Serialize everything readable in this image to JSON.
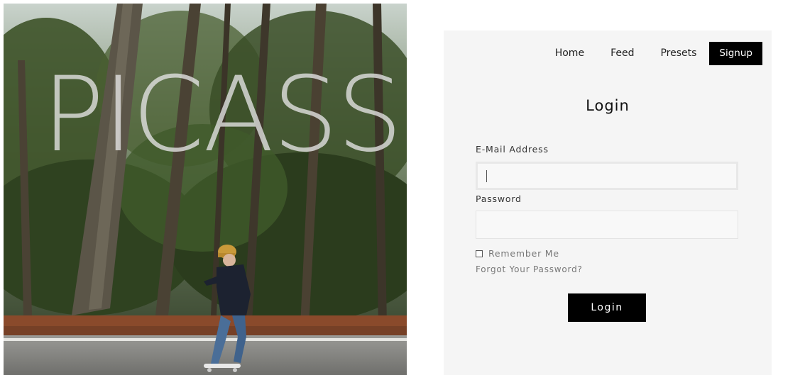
{
  "hero": {
    "brand_text": "PICASSO"
  },
  "nav": {
    "items": [
      {
        "label": "Home"
      },
      {
        "label": "Feed"
      },
      {
        "label": "Presets"
      }
    ],
    "signup_label": "Signup"
  },
  "login_form": {
    "title": "Login",
    "email_label": "E-Mail Address",
    "email_value": "",
    "password_label": "Password",
    "password_value": "",
    "remember_label": "Remember Me",
    "remember_checked": false,
    "forgot_label": "Forgot Your Password?",
    "submit_label": "Login"
  },
  "colors": {
    "card_background": "#f5f5f5",
    "button_background": "#000000",
    "button_text": "#ffffff"
  }
}
